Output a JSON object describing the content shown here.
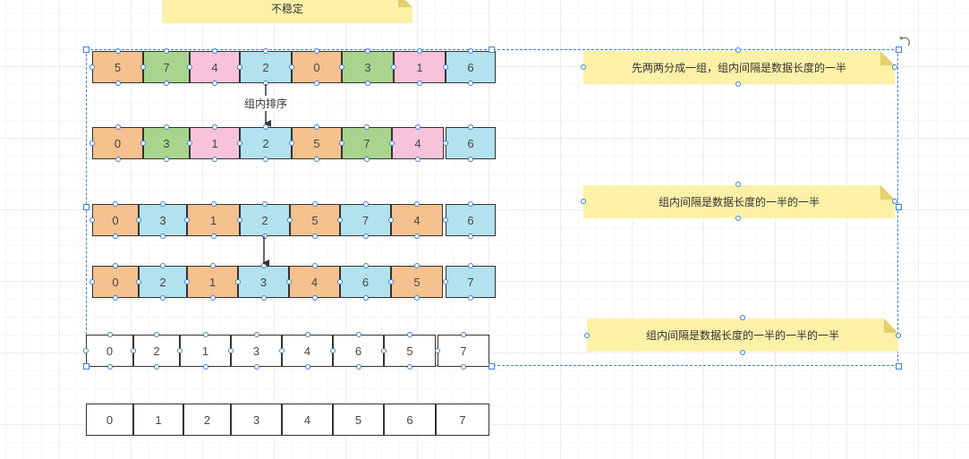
{
  "diagram": {
    "top_note": {
      "text": "不稳定"
    },
    "notes": [
      {
        "text": "先两两分成一组，组内间隔是数据长度的一半"
      },
      {
        "text": "组内间隔是数据长度的一半的一半"
      },
      {
        "text": "组内间隔是数据长度的一半的一半的一半"
      }
    ],
    "arrow_label": "组内排序",
    "rows": [
      {
        "cells": [
          {
            "value": "5",
            "color": "orange"
          },
          {
            "value": "7",
            "color": "green"
          },
          {
            "value": "4",
            "color": "pink"
          },
          {
            "value": "2",
            "color": "blue"
          },
          {
            "value": "0",
            "color": "orange"
          },
          {
            "value": "3",
            "color": "green"
          },
          {
            "value": "1",
            "color": "pink"
          },
          {
            "value": "6",
            "color": "blue"
          }
        ]
      },
      {
        "cells": [
          {
            "value": "0",
            "color": "orange"
          },
          {
            "value": "3",
            "color": "green"
          },
          {
            "value": "1",
            "color": "pink"
          },
          {
            "value": "2",
            "color": "blue"
          },
          {
            "value": "5",
            "color": "orange"
          },
          {
            "value": "7",
            "color": "green"
          },
          {
            "value": "4",
            "color": "pink"
          },
          {
            "value": "6",
            "color": "blue"
          }
        ]
      },
      {
        "cells": [
          {
            "value": "0",
            "color": "orange"
          },
          {
            "value": "3",
            "color": "blue"
          },
          {
            "value": "1",
            "color": "orange"
          },
          {
            "value": "2",
            "color": "blue"
          },
          {
            "value": "5",
            "color": "orange"
          },
          {
            "value": "7",
            "color": "blue"
          },
          {
            "value": "4",
            "color": "orange"
          },
          {
            "value": "6",
            "color": "blue"
          }
        ]
      },
      {
        "cells": [
          {
            "value": "0",
            "color": "orange"
          },
          {
            "value": "2",
            "color": "blue"
          },
          {
            "value": "1",
            "color": "orange"
          },
          {
            "value": "3",
            "color": "blue"
          },
          {
            "value": "4",
            "color": "orange"
          },
          {
            "value": "6",
            "color": "blue"
          },
          {
            "value": "5",
            "color": "orange"
          },
          {
            "value": "7",
            "color": "blue"
          }
        ]
      },
      {
        "cells": [
          {
            "value": "0",
            "color": "white"
          },
          {
            "value": "2",
            "color": "white"
          },
          {
            "value": "1",
            "color": "white"
          },
          {
            "value": "3",
            "color": "white"
          },
          {
            "value": "4",
            "color": "white"
          },
          {
            "value": "6",
            "color": "white"
          },
          {
            "value": "5",
            "color": "white"
          },
          {
            "value": "7",
            "color": "white"
          }
        ]
      },
      {
        "cells": [
          {
            "value": "0",
            "color": "white"
          },
          {
            "value": "1",
            "color": "white"
          },
          {
            "value": "2",
            "color": "white"
          },
          {
            "value": "3",
            "color": "white"
          },
          {
            "value": "4",
            "color": "white"
          },
          {
            "value": "5",
            "color": "white"
          },
          {
            "value": "6",
            "color": "white"
          },
          {
            "value": "7",
            "color": "white"
          }
        ]
      }
    ],
    "colors": {
      "orange": "#f5c18e",
      "green": "#a8d48e",
      "pink": "#f7c3d9",
      "blue": "#b2e2ee",
      "white": "#ffffff",
      "note": "#fdf1a8",
      "selection": "#3b7fd6"
    },
    "icons": {
      "rotate": "rotate-icon",
      "arrow": "arrow-down-icon"
    }
  }
}
